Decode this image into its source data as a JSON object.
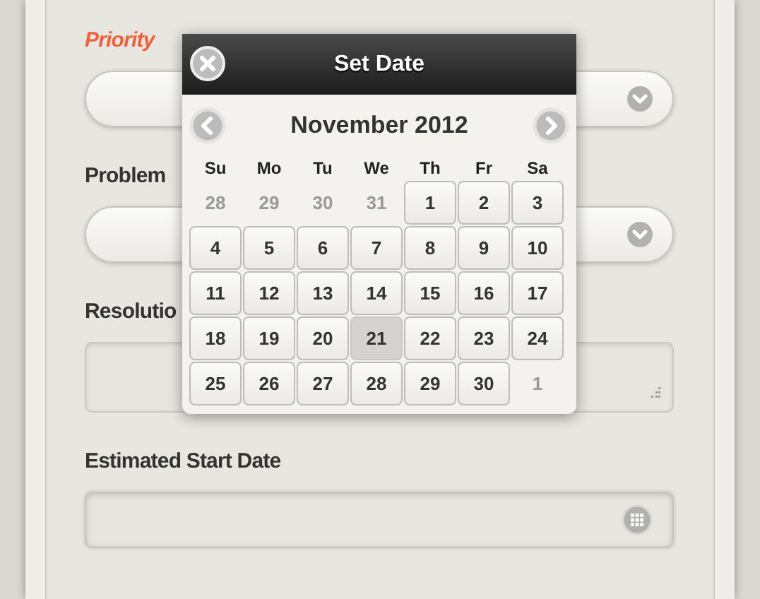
{
  "form": {
    "fields": [
      {
        "kind": "select",
        "label": "Priority",
        "required": true
      },
      {
        "kind": "select",
        "label": "Problem",
        "required": false
      },
      {
        "kind": "textarea",
        "label": "Resolutio",
        "required": false
      },
      {
        "kind": "date",
        "label": "Estimated Start Date",
        "required": false
      }
    ]
  },
  "date_picker": {
    "title": "Set Date",
    "month": "November 2012",
    "weekdays": [
      "Su",
      "Mo",
      "Tu",
      "We",
      "Th",
      "Fr",
      "Sa"
    ],
    "days": [
      {
        "label": "28",
        "in_month": false,
        "selected": false
      },
      {
        "label": "29",
        "in_month": false,
        "selected": false
      },
      {
        "label": "30",
        "in_month": false,
        "selected": false
      },
      {
        "label": "31",
        "in_month": false,
        "selected": false
      },
      {
        "label": "1",
        "in_month": true,
        "selected": false
      },
      {
        "label": "2",
        "in_month": true,
        "selected": false
      },
      {
        "label": "3",
        "in_month": true,
        "selected": false
      },
      {
        "label": "4",
        "in_month": true,
        "selected": false
      },
      {
        "label": "5",
        "in_month": true,
        "selected": false
      },
      {
        "label": "6",
        "in_month": true,
        "selected": false
      },
      {
        "label": "7",
        "in_month": true,
        "selected": false
      },
      {
        "label": "8",
        "in_month": true,
        "selected": false
      },
      {
        "label": "9",
        "in_month": true,
        "selected": false
      },
      {
        "label": "10",
        "in_month": true,
        "selected": false
      },
      {
        "label": "11",
        "in_month": true,
        "selected": false
      },
      {
        "label": "12",
        "in_month": true,
        "selected": false
      },
      {
        "label": "13",
        "in_month": true,
        "selected": false
      },
      {
        "label": "14",
        "in_month": true,
        "selected": false
      },
      {
        "label": "15",
        "in_month": true,
        "selected": false
      },
      {
        "label": "16",
        "in_month": true,
        "selected": false
      },
      {
        "label": "17",
        "in_month": true,
        "selected": false
      },
      {
        "label": "18",
        "in_month": true,
        "selected": false
      },
      {
        "label": "19",
        "in_month": true,
        "selected": false
      },
      {
        "label": "20",
        "in_month": true,
        "selected": false
      },
      {
        "label": "21",
        "in_month": true,
        "selected": true
      },
      {
        "label": "22",
        "in_month": true,
        "selected": false
      },
      {
        "label": "23",
        "in_month": true,
        "selected": false
      },
      {
        "label": "24",
        "in_month": true,
        "selected": false
      },
      {
        "label": "25",
        "in_month": true,
        "selected": false
      },
      {
        "label": "26",
        "in_month": true,
        "selected": false
      },
      {
        "label": "27",
        "in_month": true,
        "selected": false
      },
      {
        "label": "28",
        "in_month": true,
        "selected": false
      },
      {
        "label": "29",
        "in_month": true,
        "selected": false
      },
      {
        "label": "30",
        "in_month": true,
        "selected": false
      },
      {
        "label": "1",
        "in_month": false,
        "selected": false
      }
    ]
  }
}
